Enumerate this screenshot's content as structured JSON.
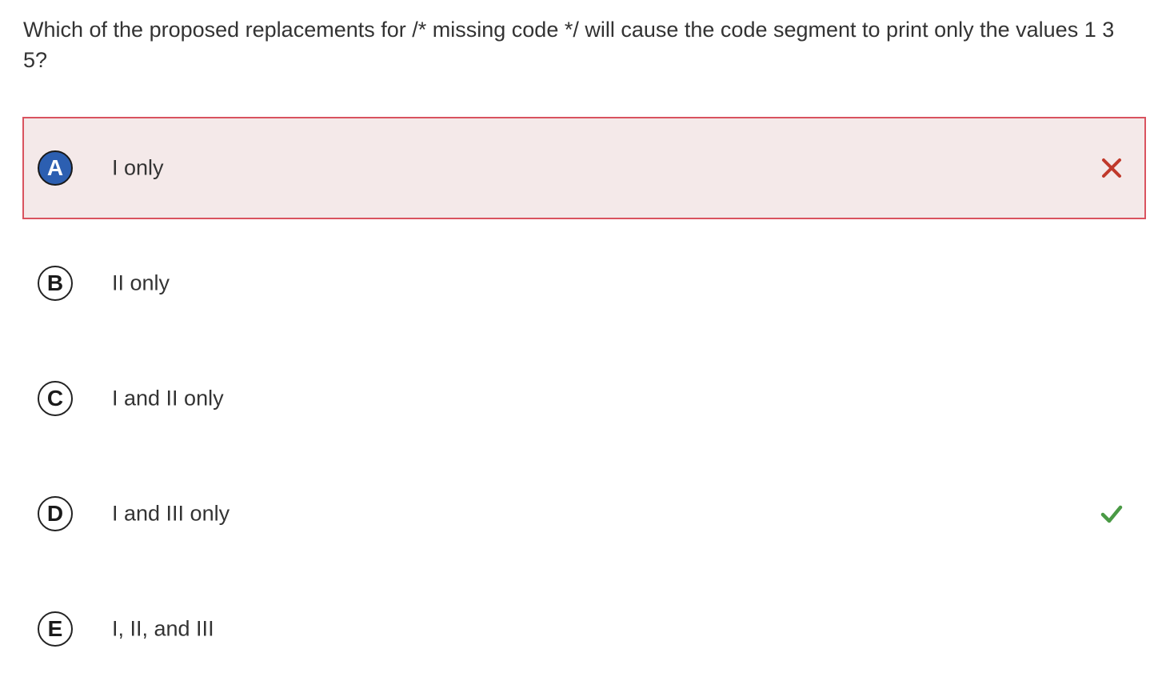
{
  "question": {
    "text": "Which of the proposed replacements for /* missing code */ will cause the code segment to print only the values 1 3 5?"
  },
  "choices": [
    {
      "letter": "A",
      "text": "I only",
      "state": "selected-incorrect",
      "mark": "x-icon"
    },
    {
      "letter": "B",
      "text": "II only",
      "state": "default",
      "mark": null
    },
    {
      "letter": "C",
      "text": "I and II only",
      "state": "default",
      "mark": null
    },
    {
      "letter": "D",
      "text": "I and III only",
      "state": "correct",
      "mark": "check-icon"
    },
    {
      "letter": "E",
      "text": "I, II, and III",
      "state": "default",
      "mark": null
    }
  ],
  "colors": {
    "incorrect_accent": "#d9535f",
    "incorrect_background": "#f4e9e9",
    "incorrect_mark": "#c0392b",
    "correct_mark": "#4a9a45",
    "selected_letter_fill": "#2c5fb1"
  }
}
